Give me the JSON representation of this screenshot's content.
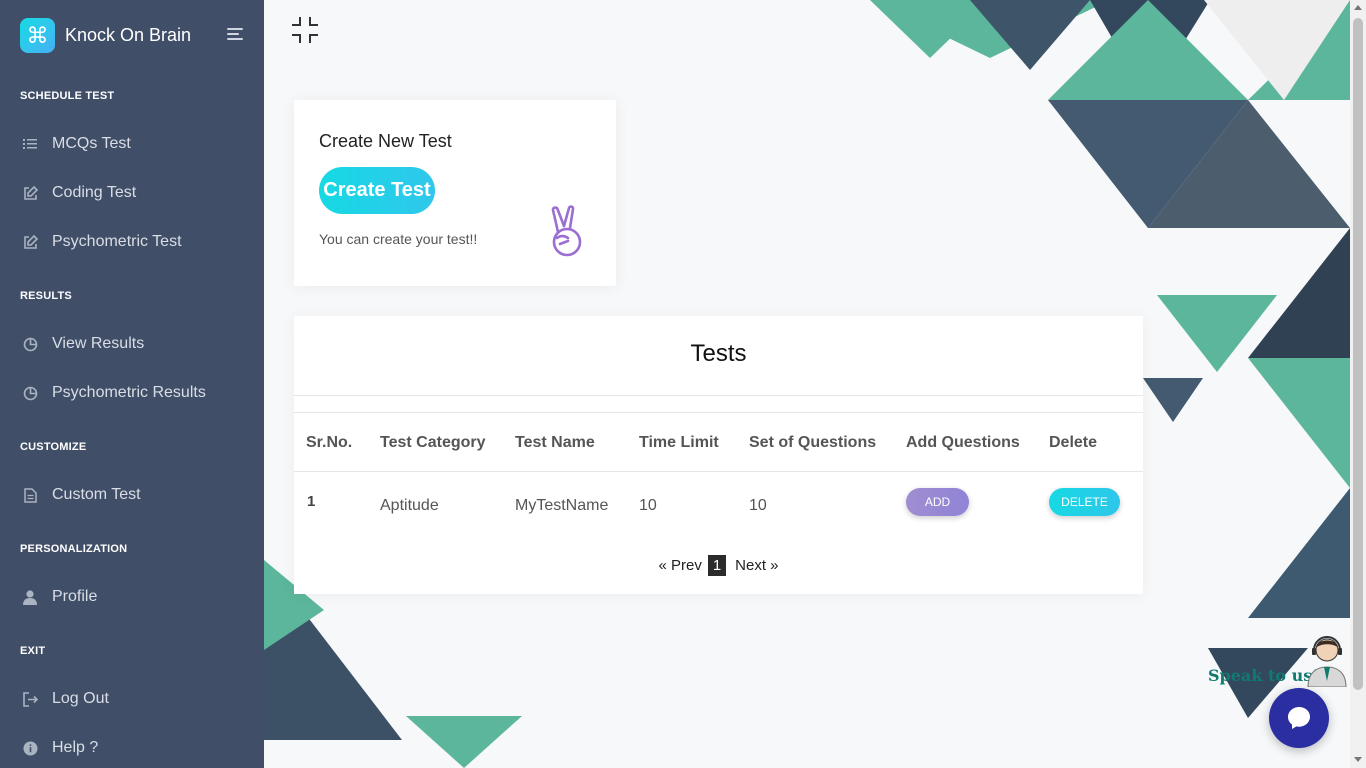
{
  "brand": {
    "logo_glyph": "⌘",
    "name": "Knock On Brain"
  },
  "sidebar": {
    "sections": [
      {
        "title": "SCHEDULE TEST"
      },
      {
        "title": "RESULTS"
      },
      {
        "title": "CUSTOMIZE"
      },
      {
        "title": "PERSONALIZATION"
      },
      {
        "title": "EXIT"
      }
    ],
    "items": [
      {
        "label": "MCQs Test",
        "icon": "list-icon"
      },
      {
        "label": "Coding Test",
        "icon": "edit-icon"
      },
      {
        "label": "Psychometric Test",
        "icon": "edit-icon"
      },
      {
        "label": "View Results",
        "icon": "pie-chart-icon"
      },
      {
        "label": "Psychometric Results",
        "icon": "pie-chart-icon"
      },
      {
        "label": "Custom Test",
        "icon": "document-icon"
      },
      {
        "label": "Profile",
        "icon": "user-icon"
      },
      {
        "label": "Log Out",
        "icon": "logout-icon"
      },
      {
        "label": "Help ?",
        "icon": "info-icon"
      }
    ]
  },
  "create_card": {
    "title": "Create New Test",
    "button_label": "Create Test",
    "subtitle": "You can create your test!!"
  },
  "tests": {
    "title": "Tests",
    "columns": [
      "Sr.No.",
      "Test Category",
      "Test Name",
      "Time Limit",
      "Set of Questions",
      "Add Questions",
      "Delete"
    ],
    "rows": [
      {
        "sr": "1",
        "category": "Aptitude",
        "name": "MyTestName",
        "time_limit": "10",
        "set_of_questions": "10",
        "add_label": "ADD",
        "delete_label": "DELETE"
      }
    ],
    "pagination": {
      "prev": "« Prev",
      "current": "1",
      "next": "Next »"
    }
  },
  "chat": {
    "speak_label": "Speak to us!"
  },
  "colors": {
    "sidebar": "#404e67",
    "accent_cyan": "#16d9e3",
    "accent_purple": "#a18cd1",
    "chat": "#2a2ea0"
  }
}
